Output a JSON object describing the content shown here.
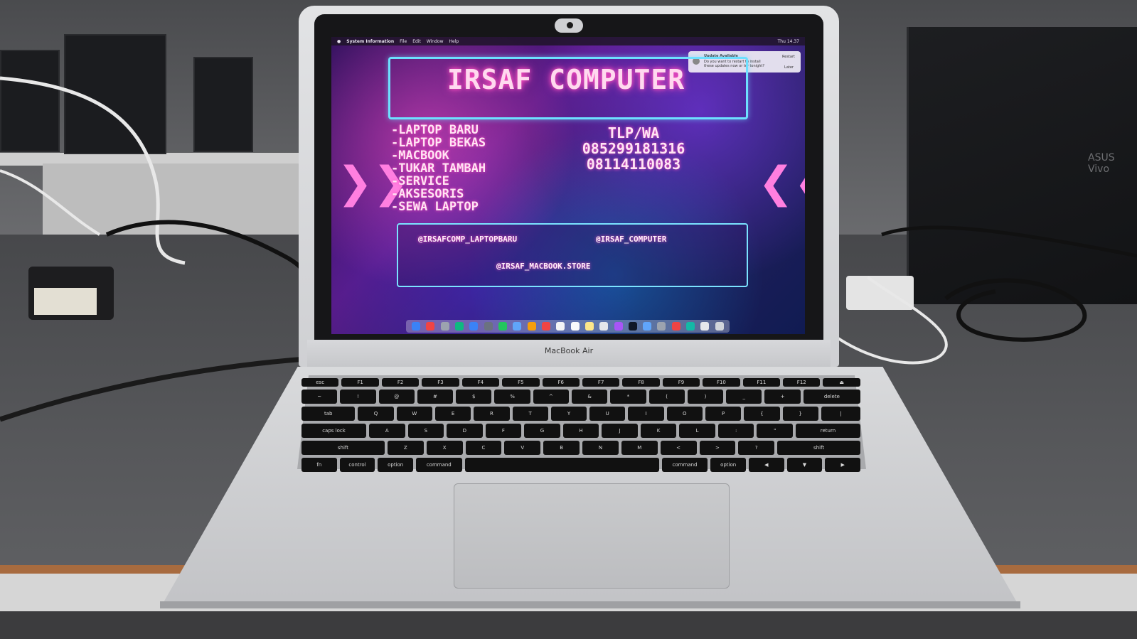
{
  "screen": {
    "menubar": {
      "app": "System Information",
      "items": [
        "File",
        "Edit",
        "Window",
        "Help"
      ],
      "clock": "Thu 14.37"
    },
    "notification": {
      "title": "Update Available",
      "body": "Do you want to restart to install these updates now or try tonight?",
      "primary": "Restart",
      "secondary": "Later"
    },
    "title": "IRSAF COMPUTER",
    "services": [
      "-LAPTOP BARU",
      "-LAPTOP BEKAS",
      "-MACBOOK",
      "-TUKAR TAMBAH",
      "-SERVICE",
      "-AKSESORIS",
      "-SEWA LAPTOP"
    ],
    "contact": {
      "label": "TLP/WA",
      "phone1": "085299181316",
      "phone2": "08114110083"
    },
    "social": {
      "s1": "@IRSAFCOMP_LAPTOPBARU",
      "s2": "@IRSAF_COMPUTER",
      "s3": "@IRSAF_MACBOOK.STORE"
    },
    "dock_colors": [
      "#3b82f6",
      "#ef4444",
      "#9ca3af",
      "#10b981",
      "#3b82f6",
      "#6b7280",
      "#22c55e",
      "#60a5fa",
      "#f59e0b",
      "#ef4444",
      "#f3f4f6",
      "#f9fafb",
      "#fde68a",
      "#e5e7eb",
      "#a855f7",
      "#111827",
      "#60a5fa",
      "#9ca3af",
      "#ef4444",
      "#14b8a6",
      "#e5e7eb",
      "#d1d5db"
    ]
  },
  "laptop": {
    "model_label": "MacBook Air"
  },
  "keyboard": {
    "fn_row": [
      "esc",
      "F1",
      "F2",
      "F3",
      "F4",
      "F5",
      "F6",
      "F7",
      "F8",
      "F9",
      "F10",
      "F11",
      "F12",
      "⏏"
    ],
    "row1": [
      "~",
      "!",
      "@",
      "#",
      "$",
      "%",
      "^",
      "&",
      "*",
      "(",
      ")",
      "_",
      "+",
      "delete"
    ],
    "row2": [
      "tab",
      "Q",
      "W",
      "E",
      "R",
      "T",
      "Y",
      "U",
      "I",
      "O",
      "P",
      "{",
      "}",
      "|"
    ],
    "row3": [
      "caps lock",
      "A",
      "S",
      "D",
      "F",
      "G",
      "H",
      "J",
      "K",
      "L",
      ":",
      "\"",
      "return"
    ],
    "row4": [
      "shift",
      "Z",
      "X",
      "C",
      "V",
      "B",
      "N",
      "M",
      "<",
      ">",
      "?",
      "shift"
    ],
    "row5": [
      "fn",
      "control",
      "option",
      "command",
      "",
      "command",
      "option",
      "◀",
      "▼",
      "▶"
    ]
  },
  "background": {
    "monitor_label": "ASUS Vivo"
  }
}
